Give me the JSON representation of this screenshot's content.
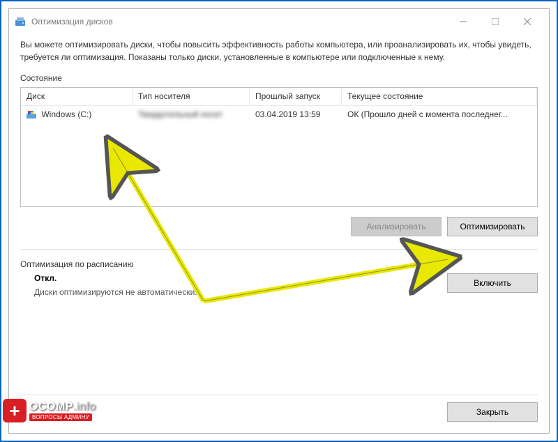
{
  "window": {
    "title": "Оптимизация дисков",
    "description": "Вы можете оптимизировать диски, чтобы повысить эффективность работы  компьютера, или проанализировать их, чтобы увидеть, требуется ли оптимизация. Показаны только диски, установленные в компьютере или подключенные к нему."
  },
  "status_section": {
    "label": "Состояние",
    "columns": {
      "disk": "Диск",
      "media_type": "Тип носителя",
      "last_run": "Прошлый запуск",
      "current_status": "Текущее состояние"
    },
    "rows": [
      {
        "disk": "Windows (C:)",
        "media_type": "Твердотельный носит",
        "last_run": "03.04.2019 13:59",
        "status": "ОК (Прошло дней с момента последнег..."
      }
    ]
  },
  "buttons": {
    "analyze": "Анализировать",
    "optimize": "Оптимизировать",
    "enable": "Включить",
    "close": "Закрыть"
  },
  "schedule": {
    "label": "Оптимизация по расписанию",
    "status": "Откл.",
    "description": "Диски оптимизируются не автоматически."
  },
  "watermark": {
    "brand": "OCOMP",
    "suffix": ".info",
    "tagline": "ВОПРОСЫ АДМИНУ"
  }
}
